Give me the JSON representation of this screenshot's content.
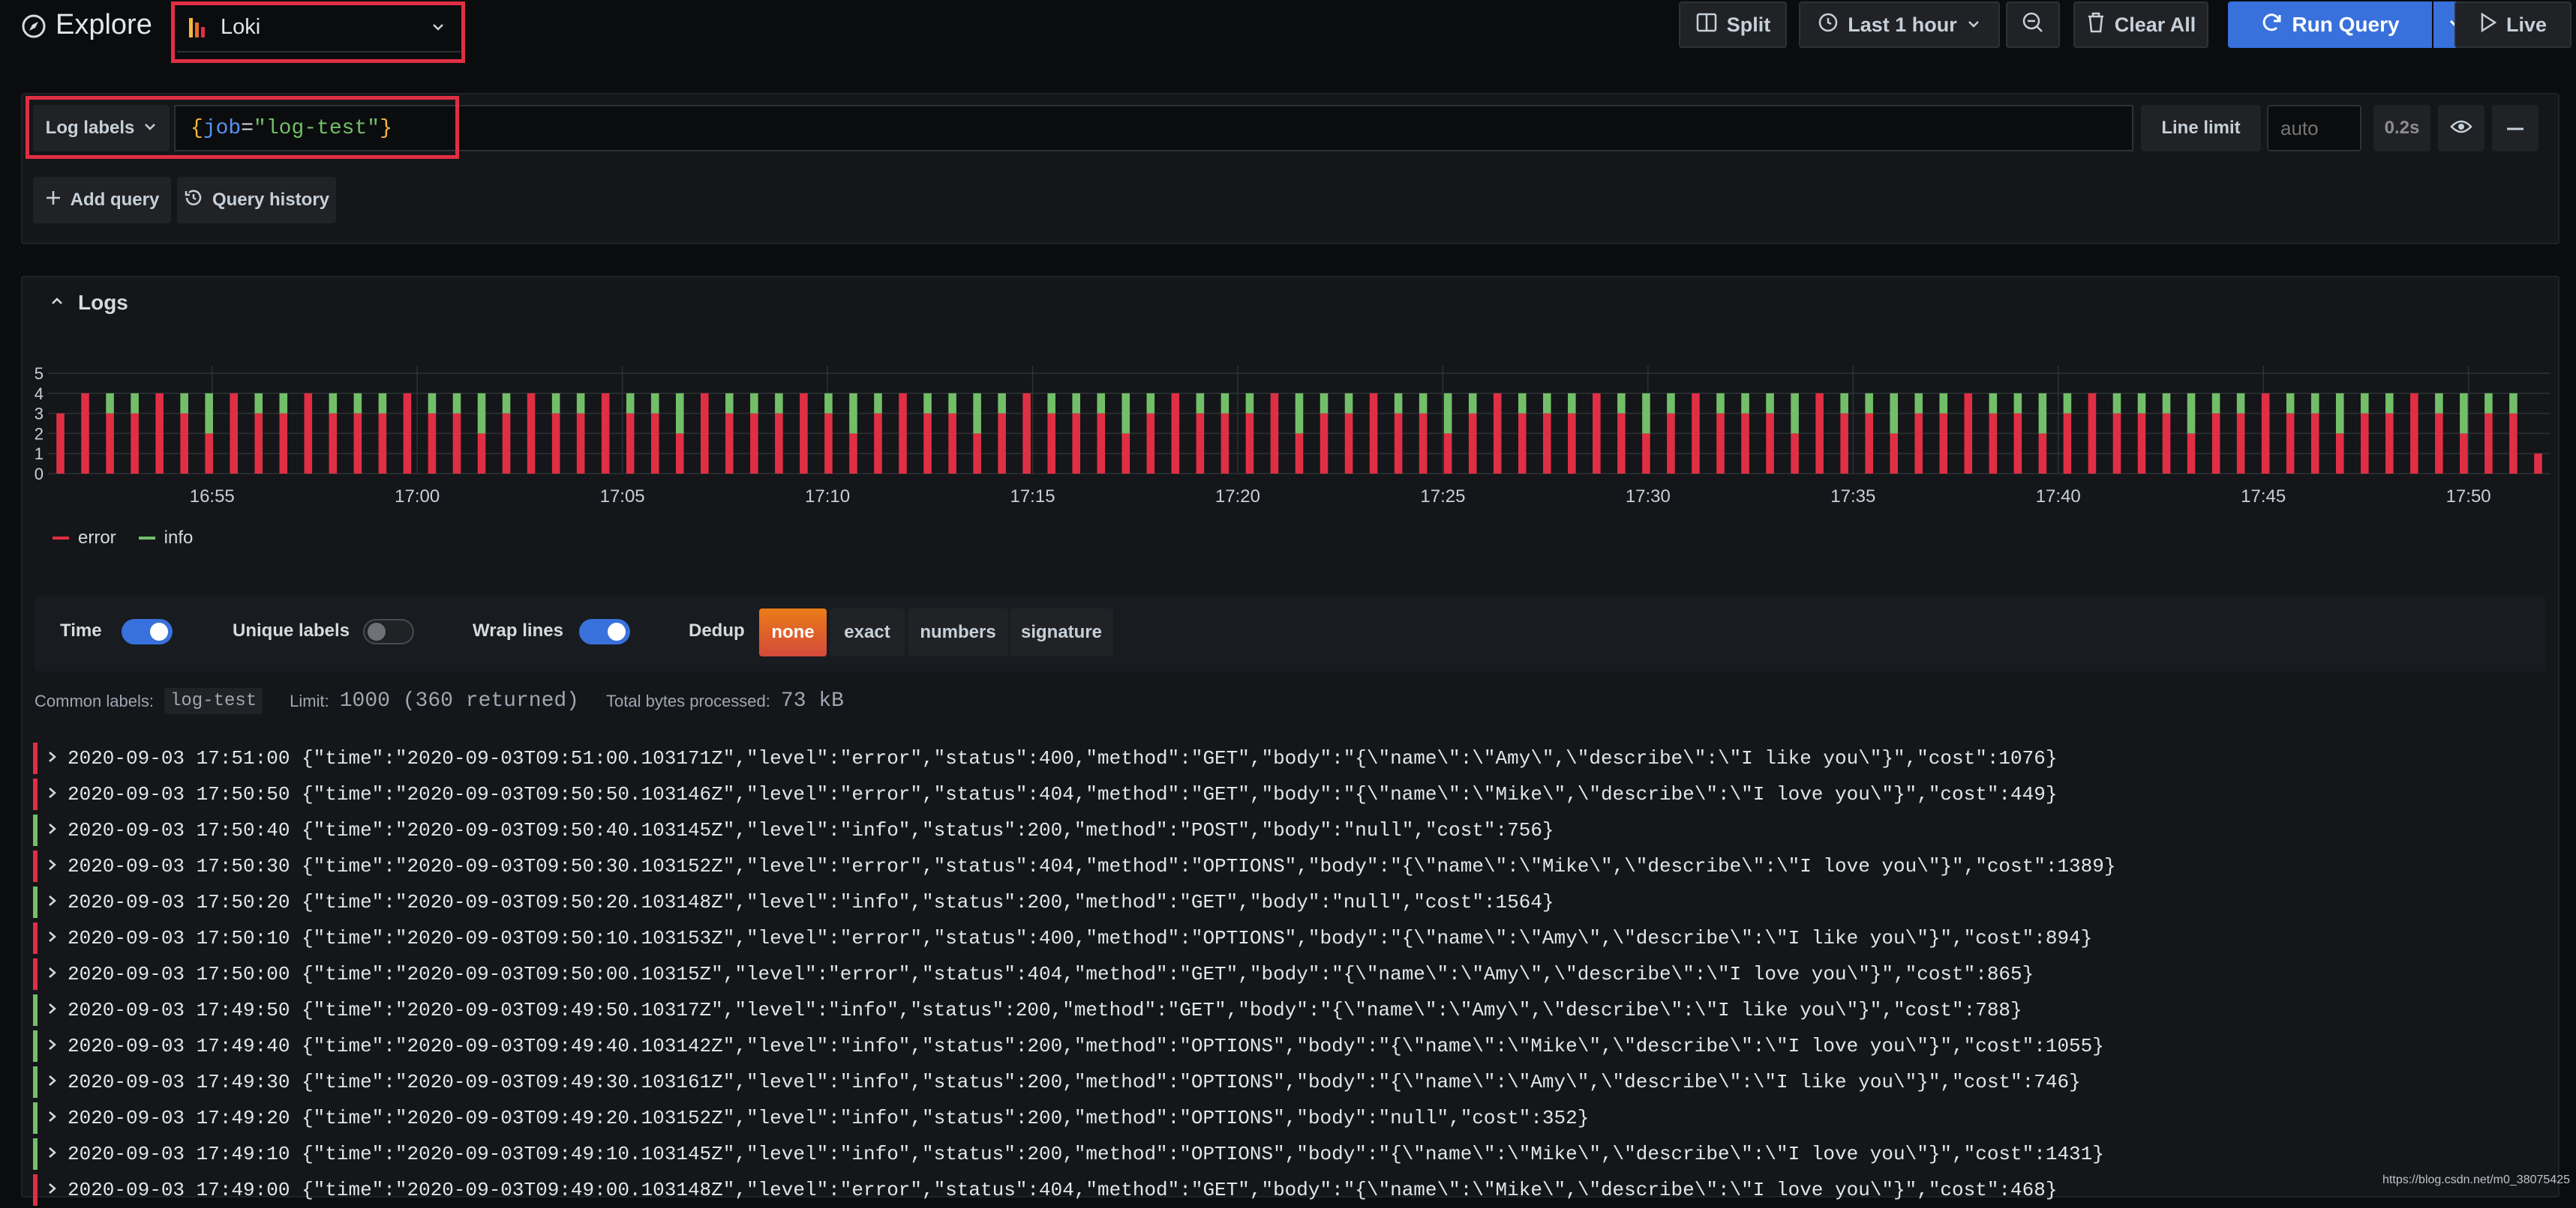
{
  "header": {
    "title": "Explore",
    "datasource": "Loki",
    "split_label": "Split",
    "time_range": "Last 1 hour",
    "clear_label": "Clear All",
    "run_label": "Run Query",
    "live_label": "Live"
  },
  "query": {
    "log_labels": "Log labels",
    "expr_open": "{",
    "expr_key": "job",
    "expr_eq": "=",
    "expr_val": "\"log-test\"",
    "expr_close": "}",
    "line_limit_label": "Line limit",
    "line_limit_placeholder": "auto",
    "duration": "0.2s",
    "add_query": "Add query",
    "query_history": "Query history"
  },
  "logs_panel": {
    "title": "Logs",
    "legend": [
      "error",
      "info"
    ],
    "colors": {
      "error": "#e02f44",
      "info": "#73bf69"
    },
    "y_ticks": [
      "5",
      "4",
      "3",
      "2",
      "1",
      "0"
    ],
    "x_ticks": [
      "16:55",
      "17:00",
      "17:05",
      "17:10",
      "17:15",
      "17:20",
      "17:25",
      "17:30",
      "17:35",
      "17:40",
      "17:45",
      "17:50"
    ]
  },
  "chart_data": {
    "type": "bar",
    "stacked": true,
    "ylim": [
      0,
      5
    ],
    "grid": true,
    "legend_position": "bottom-left",
    "x_pattern": "one bar per 10s interval from ~16:51 to 17:51",
    "series": [
      {
        "name": "error",
        "values": [
          3,
          4,
          3,
          3,
          4,
          3,
          2,
          4,
          3,
          3,
          4,
          3,
          3,
          3,
          4,
          3,
          3,
          2,
          3,
          4,
          3,
          3,
          4,
          3,
          3,
          2,
          4,
          3,
          3,
          3,
          4,
          3,
          2,
          3,
          4,
          3,
          3,
          2,
          3,
          4,
          3,
          3,
          3,
          2,
          3,
          4,
          3,
          3,
          3,
          4,
          2,
          3,
          3,
          4,
          3,
          3,
          2,
          3,
          4,
          3,
          3,
          3,
          4,
          3,
          2,
          3,
          4,
          3,
          3,
          3,
          2,
          4,
          3,
          3,
          2,
          3,
          3,
          4,
          3,
          3,
          2,
          3,
          4,
          3,
          3,
          3,
          2,
          3,
          3,
          4,
          3,
          3,
          2,
          3,
          3,
          4,
          3,
          2,
          3,
          3,
          1
        ]
      },
      {
        "name": "info",
        "values": [
          0,
          0,
          1,
          1,
          0,
          1,
          2,
          0,
          1,
          1,
          0,
          1,
          1,
          1,
          0,
          1,
          1,
          2,
          1,
          0,
          1,
          1,
          0,
          1,
          1,
          2,
          0,
          1,
          1,
          1,
          0,
          1,
          2,
          1,
          0,
          1,
          1,
          2,
          1,
          0,
          1,
          1,
          1,
          2,
          1,
          0,
          1,
          1,
          1,
          0,
          2,
          1,
          1,
          0,
          1,
          1,
          2,
          1,
          0,
          1,
          1,
          1,
          0,
          1,
          2,
          1,
          0,
          1,
          1,
          1,
          2,
          0,
          1,
          1,
          2,
          1,
          1,
          0,
          1,
          1,
          2,
          1,
          0,
          1,
          1,
          1,
          2,
          1,
          1,
          0,
          1,
          1,
          2,
          1,
          1,
          0,
          1,
          2,
          1,
          1,
          0
        ]
      }
    ]
  },
  "options": {
    "time_label": "Time",
    "unique_labels": "Unique labels",
    "wrap_lines": "Wrap lines",
    "dedup_label": "Dedup",
    "dedup_options": [
      "none",
      "exact",
      "numbers",
      "signature"
    ],
    "dedup_selected": "none"
  },
  "meta": {
    "common_labels_key": "Common labels:",
    "common_labels_val": "log-test",
    "limit_key": "Limit:",
    "limit_val": "1000 (360 returned)",
    "bytes_key": "Total bytes processed:",
    "bytes_val": "73 kB"
  },
  "logs": [
    {
      "level": "error",
      "ts": "2020-09-03 17:51:00",
      "line": "{\"time\":\"2020-09-03T09:51:00.103171Z\",\"level\":\"error\",\"status\":400,\"method\":\"GET\",\"body\":\"{\\\"name\\\":\\\"Amy\\\",\\\"describe\\\":\\\"I like you\\\"}\",\"cost\":1076}"
    },
    {
      "level": "error",
      "ts": "2020-09-03 17:50:50",
      "line": "{\"time\":\"2020-09-03T09:50:50.103146Z\",\"level\":\"error\",\"status\":404,\"method\":\"GET\",\"body\":\"{\\\"name\\\":\\\"Mike\\\",\\\"describe\\\":\\\"I love you\\\"}\",\"cost\":449}"
    },
    {
      "level": "info",
      "ts": "2020-09-03 17:50:40",
      "line": "{\"time\":\"2020-09-03T09:50:40.103145Z\",\"level\":\"info\",\"status\":200,\"method\":\"POST\",\"body\":\"null\",\"cost\":756}"
    },
    {
      "level": "error",
      "ts": "2020-09-03 17:50:30",
      "line": "{\"time\":\"2020-09-03T09:50:30.103152Z\",\"level\":\"error\",\"status\":404,\"method\":\"OPTIONS\",\"body\":\"{\\\"name\\\":\\\"Mike\\\",\\\"describe\\\":\\\"I love you\\\"}\",\"cost\":1389}"
    },
    {
      "level": "info",
      "ts": "2020-09-03 17:50:20",
      "line": "{\"time\":\"2020-09-03T09:50:20.103148Z\",\"level\":\"info\",\"status\":200,\"method\":\"GET\",\"body\":\"null\",\"cost\":1564}"
    },
    {
      "level": "error",
      "ts": "2020-09-03 17:50:10",
      "line": "{\"time\":\"2020-09-03T09:50:10.103153Z\",\"level\":\"error\",\"status\":400,\"method\":\"OPTIONS\",\"body\":\"{\\\"name\\\":\\\"Amy\\\",\\\"describe\\\":\\\"I like you\\\"}\",\"cost\":894}"
    },
    {
      "level": "error",
      "ts": "2020-09-03 17:50:00",
      "line": "{\"time\":\"2020-09-03T09:50:00.10315Z\",\"level\":\"error\",\"status\":404,\"method\":\"GET\",\"body\":\"{\\\"name\\\":\\\"Amy\\\",\\\"describe\\\":\\\"I love you\\\"}\",\"cost\":865}"
    },
    {
      "level": "info",
      "ts": "2020-09-03 17:49:50",
      "line": "{\"time\":\"2020-09-03T09:49:50.10317Z\",\"level\":\"info\",\"status\":200,\"method\":\"GET\",\"body\":\"{\\\"name\\\":\\\"Amy\\\",\\\"describe\\\":\\\"I like you\\\"}\",\"cost\":788}"
    },
    {
      "level": "info",
      "ts": "2020-09-03 17:49:40",
      "line": "{\"time\":\"2020-09-03T09:49:40.103142Z\",\"level\":\"info\",\"status\":200,\"method\":\"OPTIONS\",\"body\":\"{\\\"name\\\":\\\"Mike\\\",\\\"describe\\\":\\\"I love you\\\"}\",\"cost\":1055}"
    },
    {
      "level": "info",
      "ts": "2020-09-03 17:49:30",
      "line": "{\"time\":\"2020-09-03T09:49:30.103161Z\",\"level\":\"info\",\"status\":200,\"method\":\"OPTIONS\",\"body\":\"{\\\"name\\\":\\\"Amy\\\",\\\"describe\\\":\\\"I like you\\\"}\",\"cost\":746}"
    },
    {
      "level": "info",
      "ts": "2020-09-03 17:49:20",
      "line": "{\"time\":\"2020-09-03T09:49:20.103152Z\",\"level\":\"info\",\"status\":200,\"method\":\"OPTIONS\",\"body\":\"null\",\"cost\":352}"
    },
    {
      "level": "info",
      "ts": "2020-09-03 17:49:10",
      "line": "{\"time\":\"2020-09-03T09:49:10.103145Z\",\"level\":\"info\",\"status\":200,\"method\":\"OPTIONS\",\"body\":\"{\\\"name\\\":\\\"Mike\\\",\\\"describe\\\":\\\"I love you\\\"}\",\"cost\":1431}"
    },
    {
      "level": "error",
      "ts": "2020-09-03 17:49:00",
      "line": "{\"time\":\"2020-09-03T09:49:00.103148Z\",\"level\":\"error\",\"status\":404,\"method\":\"GET\",\"body\":\"{\\\"name\\\":\\\"Mike\\\",\\\"describe\\\":\\\"I love you\\\"}\",\"cost\":468}"
    }
  ],
  "watermark": "https://blog.csdn.net/m0_38075425"
}
